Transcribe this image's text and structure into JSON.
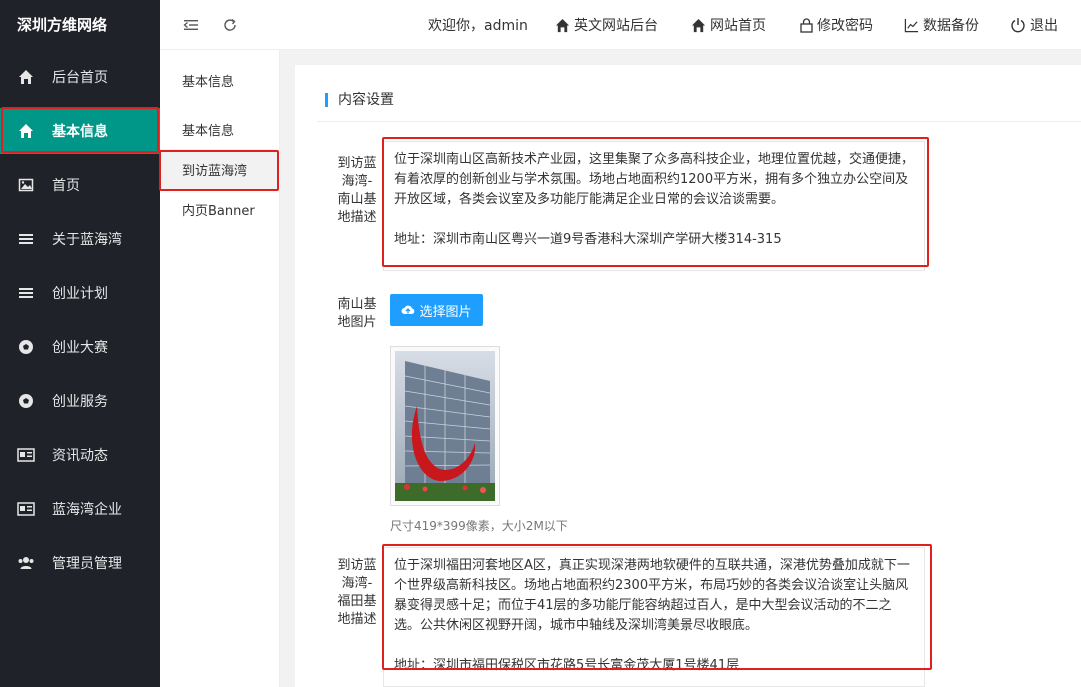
{
  "app": {
    "logo": "深圳方维网络"
  },
  "sidebar": {
    "items": [
      {
        "label": "后台首页",
        "icon": "home-icon"
      },
      {
        "label": "基本信息",
        "icon": "home-icon",
        "active": true
      },
      {
        "label": "首页",
        "icon": "image-icon"
      },
      {
        "label": "关于蓝海湾",
        "icon": "menu-icon"
      },
      {
        "label": "创业计划",
        "icon": "menu-icon"
      },
      {
        "label": "创业大赛",
        "icon": "football-icon"
      },
      {
        "label": "创业服务",
        "icon": "football-icon"
      },
      {
        "label": "资讯动态",
        "icon": "news-icon"
      },
      {
        "label": "蓝海湾企业",
        "icon": "news-icon"
      },
      {
        "label": "管理员管理",
        "icon": "users-icon"
      }
    ]
  },
  "header": {
    "welcome": "欢迎你，admin",
    "links": [
      {
        "label": "英文网站后台",
        "icon": "home-icon"
      },
      {
        "label": "网站首页",
        "icon": "home-icon"
      },
      {
        "label": "修改密码",
        "icon": "lock-icon"
      },
      {
        "label": "数据备份",
        "icon": "chart-icon"
      },
      {
        "label": "退出",
        "icon": "power-icon"
      }
    ]
  },
  "submenu": {
    "title": "基本信息",
    "items": [
      {
        "label": "基本信息"
      },
      {
        "label": "到访蓝海湾",
        "active": true
      },
      {
        "label": "内页Banner"
      }
    ]
  },
  "content": {
    "section_title": "内容设置",
    "nanshan_desc_label": "到访蓝海湾-南山基地描述",
    "nanshan_desc_value": "位于深圳南山区高新技术产业园，这里集聚了众多高科技企业，地理位置优越，交通便捷，有着浓厚的创新创业与学术氛围。场地占地面积约1200平方米，拥有多个独立办公空间及开放区域，各类会议室及多功能厅能满足企业日常的会议洽谈需要。\n\n地址：深圳市南山区粤兴一道9号香港科大深圳产学研大楼314-315",
    "nanshan_img_label": "南山基地图片",
    "upload_label": "选择图片",
    "img_hint": "尺寸419*399像素，大小2M以下",
    "futian_desc_label": "到访蓝海湾-福田基地描述",
    "futian_desc_value": "位于深圳福田河套地区A区，真正实现深港两地软硬件的互联共通，深港优势叠加成就下一个世界级高新科技区。场地占地面积约2300平方米，布局巧妙的各类会议洽谈室让头脑风暴变得灵感十足；而位于41层的多功能厅能容纳超过百人，是中大型会议活动的不二之选。公共休闲区视野开阔，城市中轴线及深圳湾美景尽收眼底。\n\n地址：深圳市福田保税区市花路5号长富金茂大厦1号楼41层"
  }
}
